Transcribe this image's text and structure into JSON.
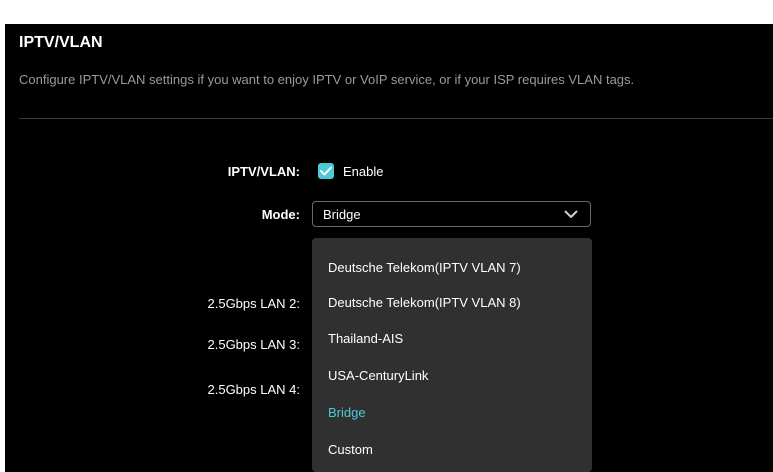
{
  "section": {
    "title": "IPTV/VLAN",
    "description": "Configure IPTV/VLAN settings if you want to enjoy IPTV or VoIP service, or if your ISP requires VLAN tags."
  },
  "form": {
    "iptv_label": "IPTV/VLAN:",
    "enable_label": "Enable",
    "enable_checked": true,
    "mode_label": "Mode:",
    "mode_value": "Bridge",
    "lan_labels": [
      "2.5Gbps LAN 2:",
      "2.5Gbps LAN 3:",
      "2.5Gbps LAN 4:"
    ]
  },
  "dropdown": {
    "options": [
      "Deutsche Telekom(IPTV VLAN 7)",
      "Deutsche Telekom(IPTV VLAN 8)",
      "Thailand-AIS",
      "USA-CenturyLink",
      "Bridge",
      "Custom"
    ],
    "selected": "Bridge"
  },
  "colors": {
    "accent": "#4acbd6",
    "background": "#000000",
    "dropdown_bg": "#303030"
  }
}
